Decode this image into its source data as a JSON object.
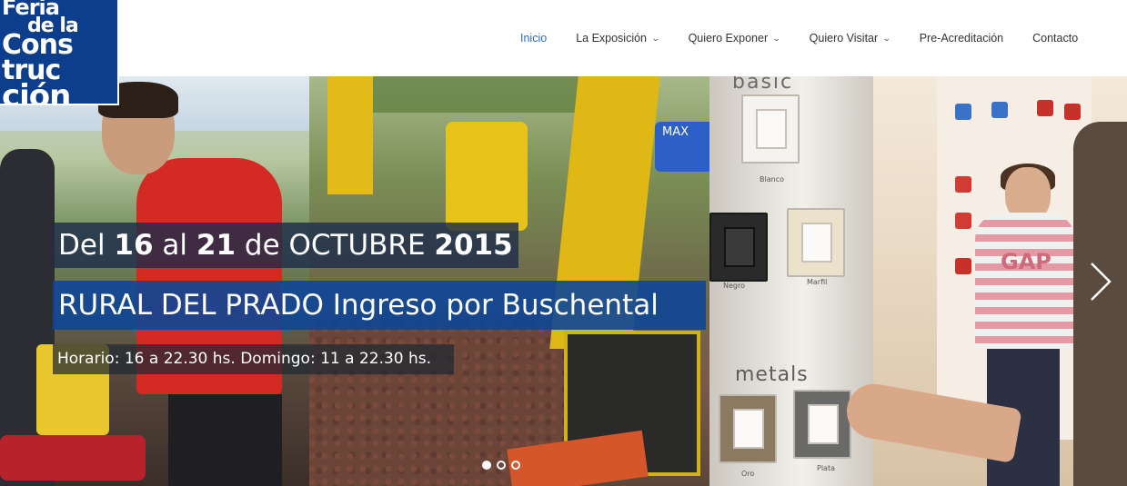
{
  "logo": {
    "line1": "Feria",
    "line2": "de la",
    "line3": "Cons",
    "line4": "truc",
    "line5": "ción"
  },
  "nav": {
    "items": [
      {
        "label": "Inicio",
        "active": true,
        "has_dropdown": false
      },
      {
        "label": "La Exposición",
        "active": false,
        "has_dropdown": true
      },
      {
        "label": "Quiero Exponer",
        "active": false,
        "has_dropdown": true
      },
      {
        "label": "Quiero Visitar",
        "active": false,
        "has_dropdown": true
      },
      {
        "label": "Pre-Acreditación",
        "active": false,
        "has_dropdown": false
      },
      {
        "label": "Contacto",
        "active": false,
        "has_dropdown": false
      }
    ],
    "chevron_icon": "chevron-down-icon",
    "active_color": "#2e6db3"
  },
  "slider": {
    "caption1": {
      "p1": "Del ",
      "n1": "16",
      "p2": " al ",
      "n2": "21",
      "p3": " de OCTUBRE ",
      "n3": "2015"
    },
    "caption2": {
      "bold": "RURAL DEL PRADO",
      "rest": " Ingreso por Buschental"
    },
    "caption3": "Horario: 16 a 22.30 hs. Domingo: 11 a 22.30 hs.",
    "photo_labels": {
      "basic": "basic",
      "metals": "metals",
      "blanco": "Blanco",
      "negro": "Negro",
      "marfil": "Marfil",
      "oro": "Oro",
      "plata": "Plata",
      "max": "MAX",
      "gap": "GAP"
    },
    "next_icon": "chevron-right-icon",
    "dots_count": 3,
    "active_dot": 0,
    "caption_colors": {
      "dark": "#1e2d4b",
      "blue": "#0e4696"
    }
  }
}
